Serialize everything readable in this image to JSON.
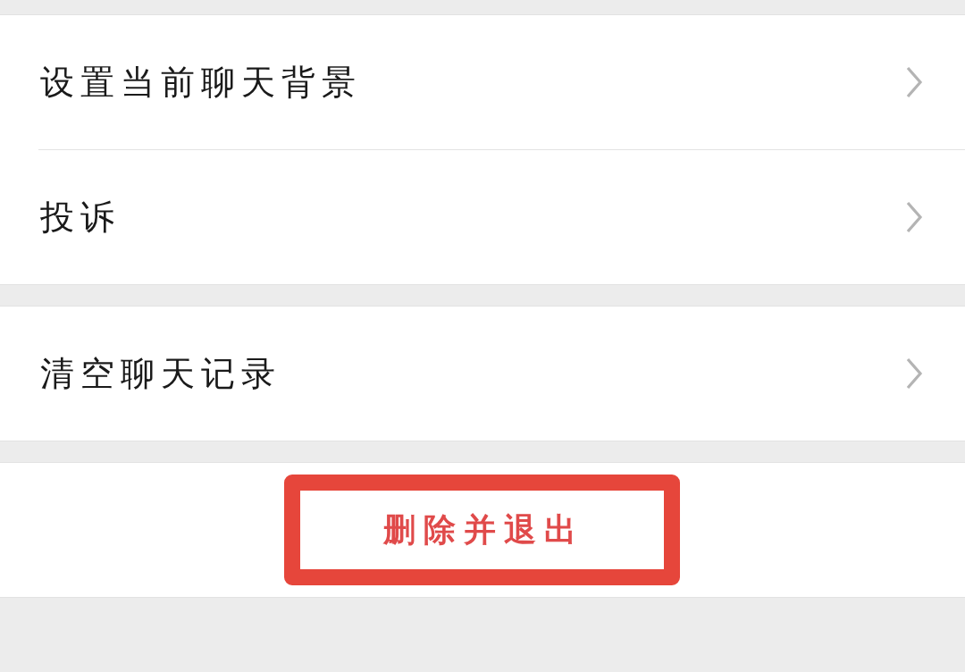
{
  "groups": [
    {
      "items": [
        {
          "label": "设置当前聊天背景"
        },
        {
          "label": "投诉"
        }
      ]
    },
    {
      "items": [
        {
          "label": "清空聊天记录"
        }
      ]
    }
  ],
  "delete_button": {
    "label": "删除并退出",
    "highlighted": true
  }
}
